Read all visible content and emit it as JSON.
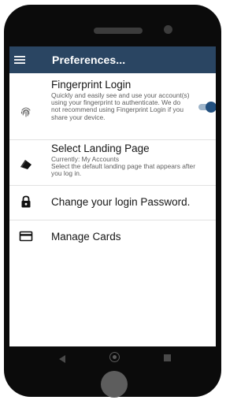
{
  "app_bar": {
    "title": "Preferences...",
    "menu_icon": "hamburger-menu-icon",
    "background_color": "#2a4562"
  },
  "settings": [
    {
      "icon": "fingerprint-icon",
      "title": "Fingerprint Login",
      "description": "Quickly and easily see and use your account(s) using your fingerprint to authenticate. We do not recommend using Fingerprint Login if you share your device.",
      "toggle_on": true
    },
    {
      "icon": "landing-page-icon",
      "title": "Select Landing Page",
      "description": "Currently: My Accounts\nSelect the default landing page that appears after you log in."
    },
    {
      "icon": "lock-icon",
      "title": "Change your login Password."
    },
    {
      "icon": "credit-card-icon",
      "title": "Manage Cards"
    }
  ],
  "toggle_colors": {
    "track": "#9fb5ca",
    "knob": "#22507f"
  },
  "system_nav": {
    "back_icon": "back-triangle-icon",
    "home_icon": "home-circle-icon",
    "recents_icon": "recents-square-icon"
  }
}
